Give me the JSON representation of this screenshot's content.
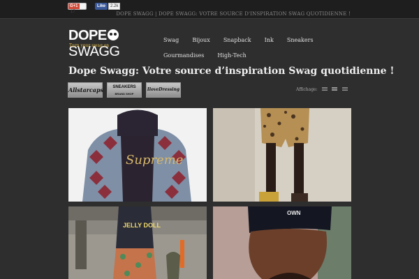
{
  "topbar": {
    "gplus_label": "G+1",
    "gplus_count": "17",
    "fb_label": "Like",
    "fb_count": "2.2k",
    "tagline": "DOPE SWAGG | DOPE SWAGG: VOTRE SOURCE D'INSPIRATION SWAG QUOTIDIENNE !"
  },
  "logo": {
    "word1": "DOPE",
    "word2": "SWAGG",
    "slogan": "Turn your swag on"
  },
  "nav": {
    "items": [
      "Swag",
      "Bijoux",
      "Snapback",
      "Ink",
      "Sneakers",
      "Gourmandises",
      "High-Tech"
    ]
  },
  "page": {
    "title": "Dope Swagg: Votre source d’inspiration Swag quotidienne !"
  },
  "brands": [
    {
      "label": "Allstarcaps"
    },
    {
      "label": "SNEAKERS",
      "sub": "BRAND SHOP"
    },
    {
      "label": "IloveDressing"
    }
  ],
  "view": {
    "label": "Affichage:",
    "icons": [
      "grid-view-icon",
      "list-compact-icon",
      "list-detail-icon"
    ]
  },
  "posts": [
    {
      "name": "post-jacket-supreme",
      "image_text": "Supreme"
    },
    {
      "name": "post-leopard-shorts"
    },
    {
      "name": "post-jelly-doll",
      "image_text": "JELLY DOLL"
    },
    {
      "name": "post-beanie-portrait",
      "image_text": "OWN"
    }
  ],
  "colors": {
    "background": "#2e2e2e",
    "topbar": "#1e1e1e",
    "slogan": "#e8c04a",
    "facebook": "#3b5998",
    "gplus": "#d14836"
  }
}
